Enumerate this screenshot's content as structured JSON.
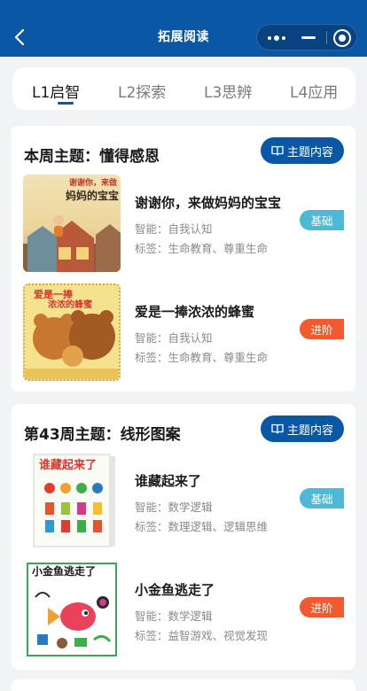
{
  "navbar": {
    "title": "拓展阅读",
    "back_icon": "chevron-left-icon",
    "capsule_icons": [
      "more-dots-icon",
      "minimize-icon",
      "close-target-icon"
    ]
  },
  "tabs": [
    {
      "label": "L1启智",
      "active": true
    },
    {
      "label": "L2探索",
      "active": false
    },
    {
      "label": "L3思辨",
      "active": false
    },
    {
      "label": "L4应用",
      "active": false
    }
  ],
  "sections": [
    {
      "title": "本周主题：懂得感恩",
      "theme_button": "主题内容",
      "books": [
        {
          "title": "谢谢你，来做妈妈的宝宝",
          "ability": "智能：自我认知",
          "tags": "标签：生命教育、尊重生命",
          "level": "基础",
          "cover": {
            "line1": "谢谢你，来做",
            "line2": "妈妈的宝宝"
          }
        },
        {
          "title": "爱是一捧浓浓的蜂蜜",
          "ability": "智能：自我认知",
          "tags": "标签：生命教育、尊重生命",
          "level": "进阶",
          "cover": {
            "line1": "爱是一捧",
            "line2": "浓浓的蜂蜜"
          }
        }
      ]
    },
    {
      "title": "第43周主题：线形图案",
      "theme_button": "主题内容",
      "books": [
        {
          "title": "谁藏起来了",
          "ability": "智能：数学逻辑",
          "tags": "标签：数理逻辑、逻辑思维",
          "level": "基础",
          "cover": {
            "line1": "谁藏起来了"
          }
        },
        {
          "title": "小金鱼逃走了",
          "ability": "智能：数学逻辑",
          "tags": "标签：益智游戏、视觉发现",
          "level": "进阶",
          "cover": {
            "line1": "小金鱼逃走了"
          }
        }
      ]
    }
  ],
  "colors": {
    "brand": "#0a57a6",
    "badge_basic": "#4cbad6",
    "badge_advanced": "#f05a2e",
    "background": "#f2f3f5"
  }
}
